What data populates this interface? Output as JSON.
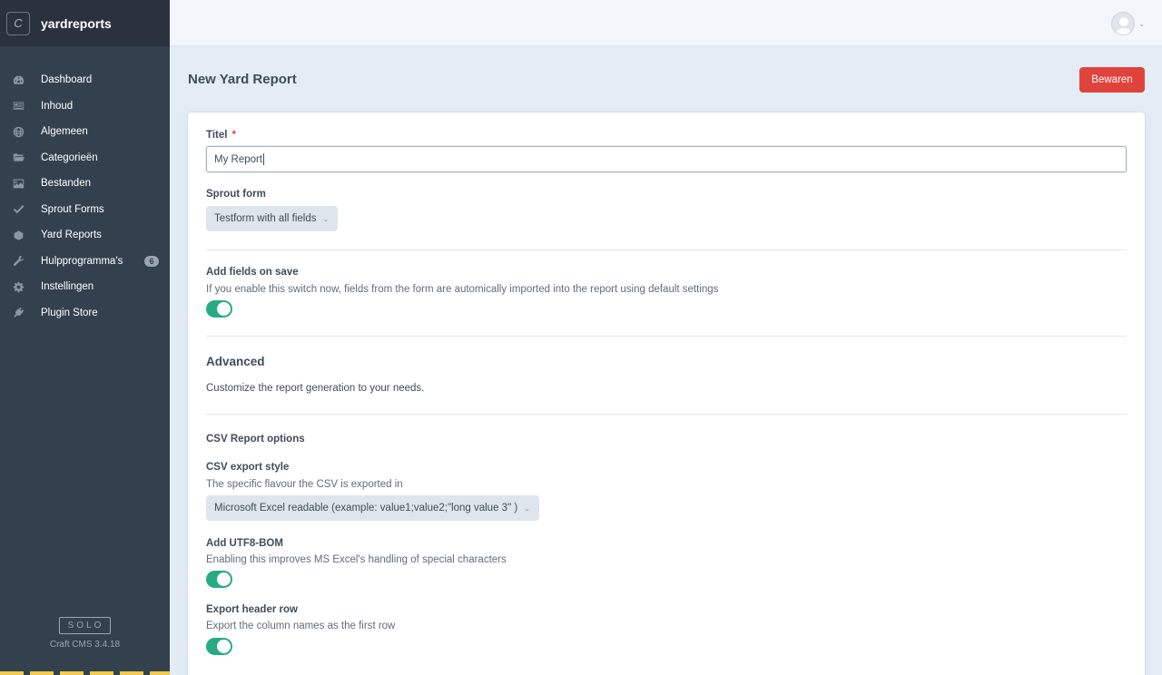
{
  "sidebar": {
    "site_logo": "C",
    "site_name": "yardreports",
    "nav": [
      {
        "label": "Dashboard",
        "icon": "dashboard-icon"
      },
      {
        "label": "Inhoud",
        "icon": "entries-icon"
      },
      {
        "label": "Algemeen",
        "icon": "globe-icon"
      },
      {
        "label": "Categorieën",
        "icon": "folder-icon"
      },
      {
        "label": "Bestanden",
        "icon": "image-icon"
      },
      {
        "label": "Sprout Forms",
        "icon": "check-icon"
      },
      {
        "label": "Yard Reports",
        "icon": "hexagon-icon"
      },
      {
        "label": "Hulpprogramma's",
        "icon": "wrench-icon",
        "badge": "6"
      },
      {
        "label": "Instellingen",
        "icon": "gear-icon"
      },
      {
        "label": "Plugin Store",
        "icon": "plug-icon"
      }
    ],
    "edition": "SOLO",
    "version": "Craft CMS 3.4.18"
  },
  "header": {
    "title": "New Yard Report",
    "save_label": "Bewaren"
  },
  "form": {
    "title_label": "Titel",
    "title_required": "*",
    "title_value": "My Report",
    "sprout_label": "Sprout form",
    "sprout_value": "Testform with all fields",
    "add_fields_label": "Add fields on save",
    "add_fields_instr": "If you enable this switch now, fields from the form are automically imported into the report using default settings",
    "add_fields_on": true,
    "advanced_title": "Advanced",
    "advanced_text": "Customize the report generation to your needs.",
    "csv_options_title": "CSV Report options",
    "csv_style_label": "CSV export style",
    "csv_style_instr": "The specific flavour the CSV is exported in",
    "csv_style_value": "Microsoft Excel readable (example: value1;value2;\"long value 3\" )",
    "utf8_label": "Add UTF8-BOM",
    "utf8_instr": "Enabling this improves MS Excel's handling of special characters",
    "utf8_on": true,
    "header_row_label": "Export header row",
    "header_row_instr": "Export the column names as the first row",
    "header_row_on": true
  },
  "colors": {
    "sidebar": "#33414e",
    "accent_red": "#e0433b",
    "toggle_green": "#27ab83",
    "background": "#e4edf6"
  }
}
